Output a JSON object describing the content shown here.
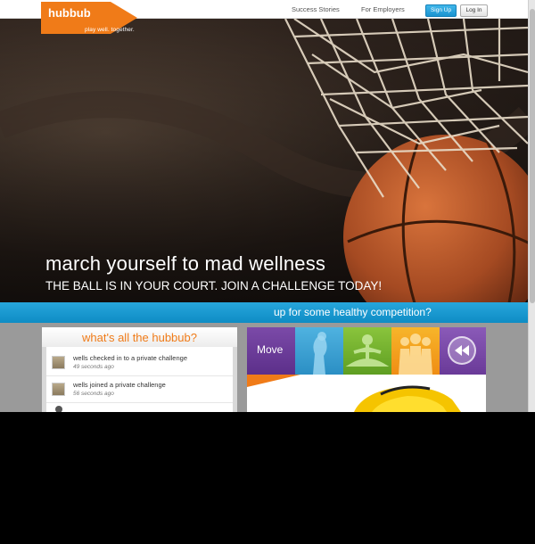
{
  "brand": {
    "name": "hubbub",
    "tagline": "play well. together.",
    "accent": "#f07b18"
  },
  "nav": {
    "links": [
      "Success Stories",
      "For Employers"
    ],
    "signup_label": "Sign Up",
    "login_label": "Log In"
  },
  "hero": {
    "title": "march yourself to mad wellness",
    "subtitle": "THE BALL IS IN YOUR COURT. JOIN A CHALLENGE TODAY!"
  },
  "stripe": {
    "text": "up for some healthy competition?"
  },
  "activity": {
    "title": "what's all the hubbub?",
    "items": [
      {
        "text": "wells checked in to a private challenge",
        "time": "49 seconds ago"
      },
      {
        "text": "wells joined a private challenge",
        "time": "56 seconds ago"
      }
    ]
  },
  "categories": {
    "first_label": "Move",
    "icons": [
      "runner-icon",
      "meditation-icon",
      "group-icon",
      "rewind-icon"
    ]
  }
}
